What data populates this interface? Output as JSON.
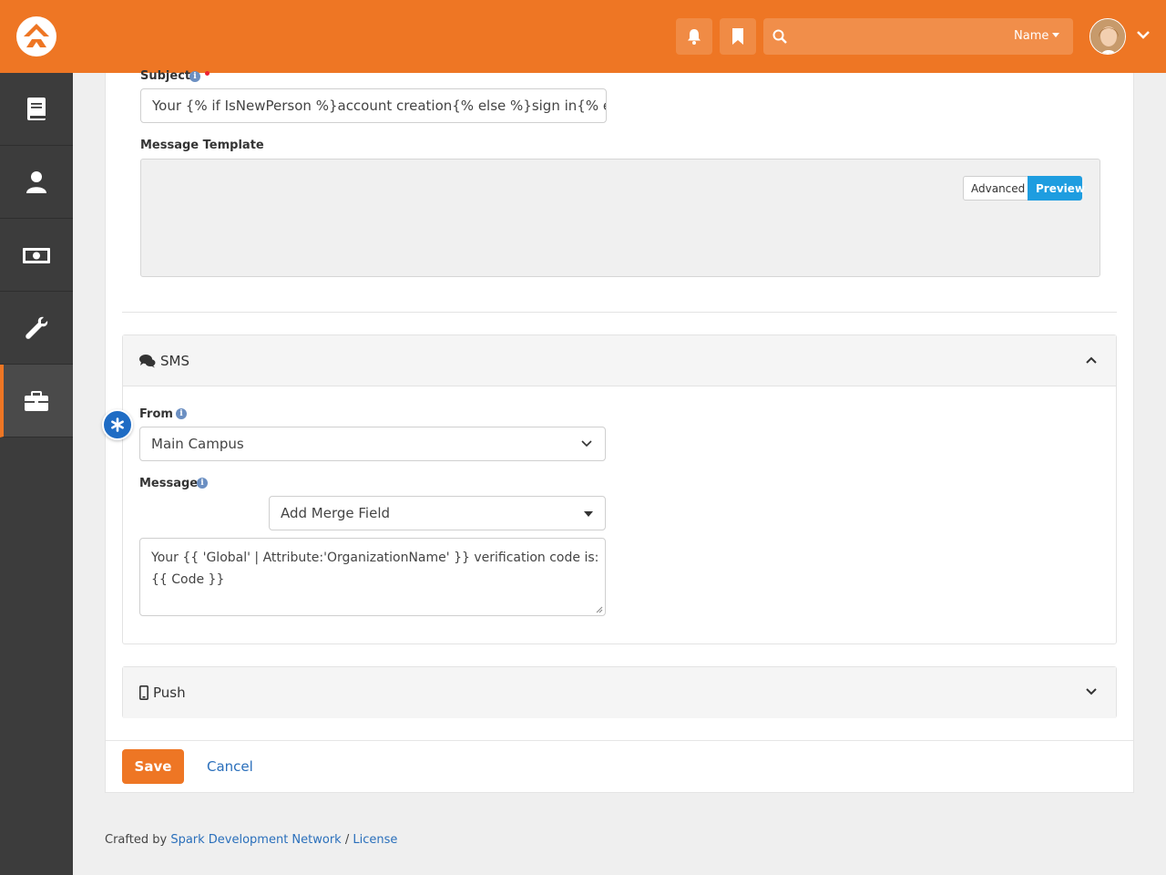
{
  "topbar": {
    "logo_icon": "rock-logo-icon",
    "notifications_icon": "bell-icon",
    "bookmarks_icon": "bookmark-icon",
    "search": {
      "icon": "search-icon",
      "value": "",
      "filter_label": "Name"
    },
    "user_menu_icon": "chevron-down-icon"
  },
  "sidebar": {
    "items": [
      {
        "icon": "book-icon"
      },
      {
        "icon": "person-icon"
      },
      {
        "icon": "money-icon"
      },
      {
        "icon": "wrench-icon"
      },
      {
        "icon": "briefcase-icon",
        "active": true
      }
    ]
  },
  "email": {
    "subject_label": "Subject",
    "subject_value": "Your {% if IsNewPerson %}account creation{% else %}sign in{% endif %} code",
    "message_template_label": "Message Template",
    "mode_advanced": "Advanced",
    "mode_preview": "Preview"
  },
  "sms": {
    "title": "SMS",
    "from_label": "From",
    "from_value": "Main Campus",
    "message_label": "Message",
    "merge_field_label": "Add Merge Field",
    "message_line1": "Your {{ 'Global' | Attribute:'OrganizationName' }} verification code is:",
    "message_line2": "{{ Code }}"
  },
  "push": {
    "title": "Push"
  },
  "actions": {
    "save": "Save",
    "cancel": "Cancel"
  },
  "footer": {
    "crafted_by": "Crafted by",
    "org_link": "Spark Development Network",
    "separator": "/",
    "license_link": "License"
  },
  "colors": {
    "brand": "#ee7624",
    "sidebar": "#3c3c3c",
    "link": "#2a6fbb",
    "preview_active": "#1e9de0"
  }
}
